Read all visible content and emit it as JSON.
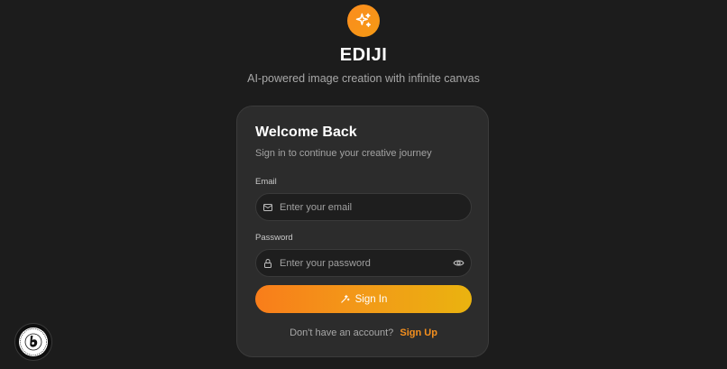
{
  "brand": {
    "icon": "sparkles-icon",
    "title": "EDIJI",
    "tagline": "AI-powered image creation with infinite canvas",
    "accent": "#f7931a"
  },
  "card": {
    "title": "Welcome Back",
    "subtitle": "Sign in to continue your creative journey",
    "email": {
      "label": "Email",
      "placeholder": "Enter your email",
      "value": "",
      "icon": "mail-icon"
    },
    "password": {
      "label": "Password",
      "placeholder": "Enter your password",
      "value": "",
      "icon": "lock-icon",
      "toggle_icon": "eye-icon"
    },
    "sign_in": {
      "label": "Sign In",
      "icon": "wand-icon"
    },
    "footer": {
      "prompt": "Don't have an account?",
      "link": "Sign Up"
    }
  },
  "badge": {
    "icon": "built-with-bolt-badge"
  }
}
